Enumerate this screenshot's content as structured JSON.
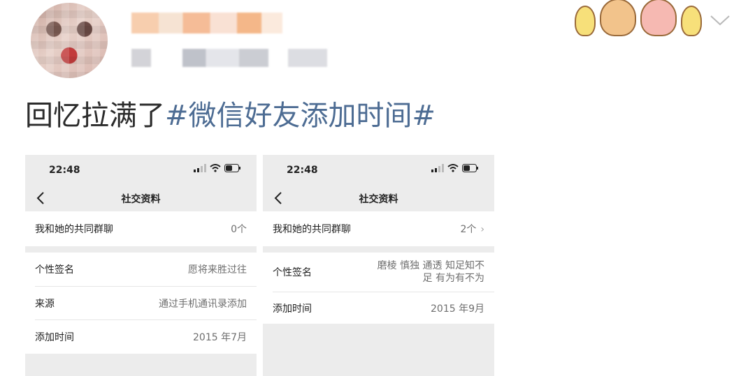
{
  "post": {
    "text_plain": "回忆拉满了",
    "hashtag": "#微信好友添加时间#"
  },
  "shots": [
    {
      "status_time": "22:48",
      "nav_title": "社交资料",
      "group_label": "我和她的共同群聊",
      "group_value": "0个",
      "signature_label": "个性签名",
      "signature_value": "愿将来胜过往",
      "source_label": "来源",
      "source_value": "通过手机通讯录添加",
      "added_label": "添加时间",
      "added_value": "2015 年7月"
    },
    {
      "status_time": "22:48",
      "nav_title": "社交资料",
      "group_label": "我和她的共同群聊",
      "group_value": "2个",
      "signature_label": "个性签名",
      "signature_value_line1": "磨棱 慎独 通透 知足知不",
      "signature_value_line2": "足 有为有不为",
      "added_label": "添加时间",
      "added_value": "2015 年9月"
    }
  ],
  "icons": {
    "chevron": "chevron-down-icon",
    "back": "back-arrow-icon",
    "signal": "signal-icon",
    "wifi": "wifi-icon",
    "battery": "battery-icon",
    "row_chevron": "chevron-right-icon"
  }
}
